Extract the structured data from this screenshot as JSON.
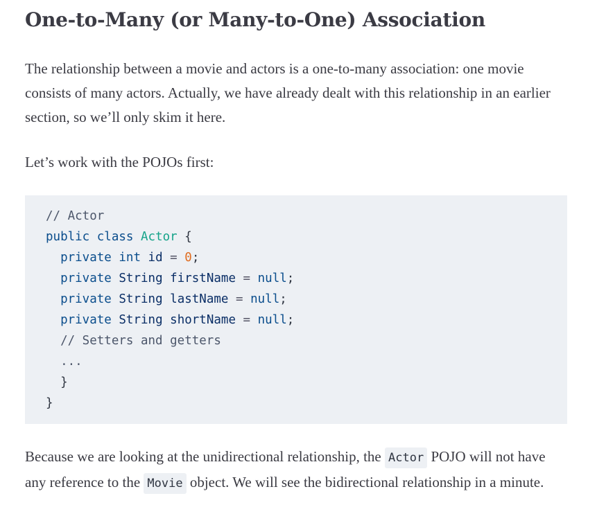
{
  "heading": "One-to-Many (or Many-to-One) Association",
  "paragraph1": "The relationship between a movie and actors is a one-to-many association: one movie consists of many actors. Actually, we have already dealt with this relationship in an earlier section, so we’ll only skim it here.",
  "paragraph2": "Let’s work with the POJOs first:",
  "code": {
    "l1_comment": "// Actor",
    "l2_public": "public",
    "l2_class": "class",
    "l2_name": "Actor",
    "l2_brace": "{",
    "l3_private": "private",
    "l3_type": "int",
    "l3_name": "id",
    "l3_value": "0",
    "l4_private": "private",
    "l4_type": "String",
    "l4_name": "firstName",
    "l4_value": "null",
    "l5_private": "private",
    "l5_type": "String",
    "l5_name": "lastName",
    "l5_value": "null",
    "l6_private": "private",
    "l6_type": "String",
    "l6_name": "shortName",
    "l6_value": "null",
    "l7_comment": "// Setters and getters",
    "l8_ellipsis": "...",
    "l9_brace": "}",
    "l10_brace": "}"
  },
  "paragraph3": {
    "part1": "Because we are looking at the unidirectional relationship, the",
    "code1": "Actor",
    "part2": "POJO will not have any reference to the",
    "code2": "Movie",
    "part3": "object. We will see the bidirectional relationship in a minute."
  }
}
